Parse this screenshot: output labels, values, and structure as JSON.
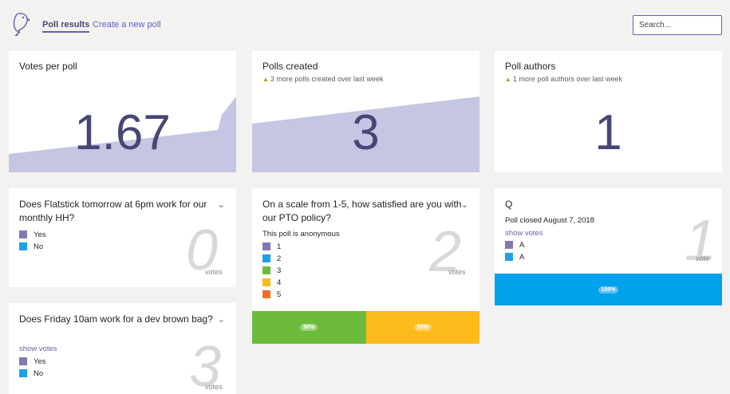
{
  "nav": {
    "poll_results": "Poll results",
    "create_poll": "Create a new poll",
    "search_placeholder": "Search..."
  },
  "stats": {
    "votes_per_poll": {
      "title": "Votes per poll",
      "value": "1.67"
    },
    "polls_created": {
      "title": "Polls created",
      "sub": "3 more polls created over last week",
      "value": "3"
    },
    "poll_authors": {
      "title": "Poll authors",
      "sub": "1 more poll authors over last week",
      "value": "1"
    }
  },
  "polls": [
    {
      "question": "Does Flatstick tomorrow at 6pm work for our monthly HH?",
      "count": "0",
      "votes_label": "votes",
      "options": [
        {
          "label": "Yes",
          "color": "#8378b7"
        },
        {
          "label": "No",
          "color": "#1ea0e6"
        }
      ]
    },
    {
      "question": "Does Friday 10am work for a dev brown bag?",
      "show_votes": "show votes",
      "count": "3",
      "votes_label": "votes",
      "options": [
        {
          "label": "Yes",
          "color": "#8378b7"
        },
        {
          "label": "No",
          "color": "#1ea0e6"
        }
      ]
    },
    {
      "question": "On a scale from 1-5, how satisfied are you with our PTO policy?",
      "note": "This poll is anonymous",
      "count": "2",
      "votes_label": "votes",
      "options": [
        {
          "label": "1",
          "color": "#8378b7"
        },
        {
          "label": "2",
          "color": "#1ea0e6"
        },
        {
          "label": "3",
          "color": "#6cbb3c"
        },
        {
          "label": "4",
          "color": "#fdbb1b"
        },
        {
          "label": "5",
          "color": "#f36e1f"
        }
      ],
      "results": [
        {
          "label": "50%",
          "share": 0.5,
          "color": "#6cbb3c"
        },
        {
          "label": "50%",
          "share": 0.5,
          "color": "#fdbb1b"
        }
      ]
    },
    {
      "question": "Q",
      "closed": "Poll closed August 7, 2018",
      "show_votes": "show votes",
      "count": "1",
      "votes_label": "vote",
      "options": [
        {
          "label": "A",
          "color": "#8378b7"
        },
        {
          "label": "A",
          "color": "#1ea0e6"
        }
      ],
      "results": [
        {
          "label": "100%",
          "share": 1.0,
          "color": "#00a2ed"
        }
      ]
    }
  ],
  "colors": {
    "accent": "#6264a7",
    "chart_fill": "#c5c5e4",
    "stat_number": "#464775"
  }
}
